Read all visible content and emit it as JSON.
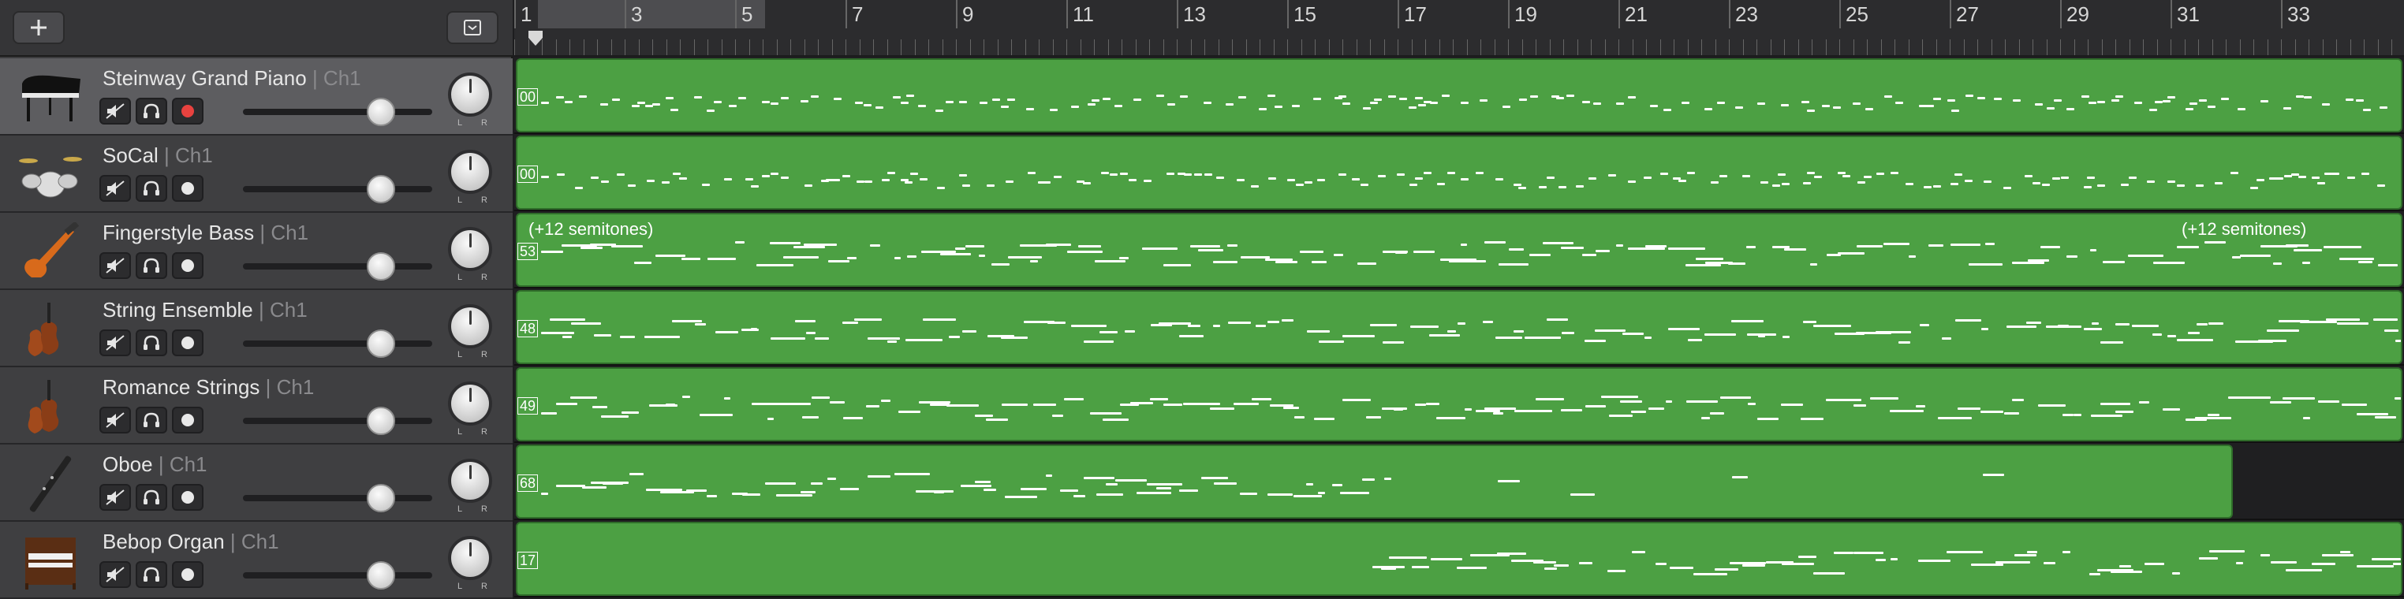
{
  "header": {
    "add_icon": "plus-icon",
    "filter_icon": "tray-down-icon"
  },
  "ruler": {
    "bar_numbers": [
      "1",
      "3",
      "5",
      "7",
      "9",
      "11",
      "13",
      "15",
      "17",
      "19",
      "21",
      "23",
      "25",
      "27",
      "29",
      "31",
      "33"
    ]
  },
  "tracks": [
    {
      "name": "Steinway Grand Piano",
      "channel": "Ch1",
      "instrument": "grand-piano-icon",
      "selected": true,
      "record_armed": true,
      "volume": 0.73,
      "pan_labels": [
        "L",
        "R"
      ],
      "region": {
        "label": "",
        "start_num": "00",
        "length": 1,
        "transpose": ""
      }
    },
    {
      "name": "SoCal",
      "channel": "Ch1",
      "instrument": "drum-kit-icon",
      "selected": false,
      "record_armed": false,
      "volume": 0.73,
      "pan_labels": [
        "L",
        "R"
      ],
      "region": {
        "label": "",
        "start_num": "00",
        "length": 1,
        "transpose": ""
      }
    },
    {
      "name": "Fingerstyle Bass",
      "channel": "Ch1",
      "instrument": "electric-bass-icon",
      "selected": false,
      "record_armed": false,
      "volume": 0.73,
      "pan_labels": [
        "L",
        "R"
      ],
      "region": {
        "label": "",
        "start_num": "53",
        "length": 1,
        "transpose": "(+12 semitones)"
      }
    },
    {
      "name": "String Ensemble",
      "channel": "Ch1",
      "instrument": "strings-icon",
      "selected": false,
      "record_armed": false,
      "volume": 0.73,
      "pan_labels": [
        "L",
        "R"
      ],
      "region": {
        "label": "",
        "start_num": "48",
        "length": 1,
        "transpose": ""
      }
    },
    {
      "name": "Romance Strings",
      "channel": "Ch1",
      "instrument": "strings-icon",
      "selected": false,
      "record_armed": false,
      "volume": 0.73,
      "pan_labels": [
        "L",
        "R"
      ],
      "region": {
        "label": "",
        "start_num": "49",
        "length": 1,
        "transpose": ""
      }
    },
    {
      "name": "Oboe",
      "channel": "Ch1",
      "instrument": "oboe-icon",
      "selected": false,
      "record_armed": false,
      "volume": 0.73,
      "pan_labels": [
        "L",
        "R"
      ],
      "region": {
        "label": "",
        "start_num": "68",
        "length": 0.91,
        "transpose": ""
      }
    },
    {
      "name": "Bebop Organ",
      "channel": "Ch1",
      "instrument": "organ-icon",
      "selected": false,
      "record_armed": false,
      "volume": 0.73,
      "pan_labels": [
        "L",
        "R"
      ],
      "region": {
        "label": "",
        "start_num": "17",
        "length": 1,
        "transpose": ""
      }
    }
  ],
  "colors": {
    "region_green": "#4ca043",
    "record_red": "#e8423f"
  }
}
